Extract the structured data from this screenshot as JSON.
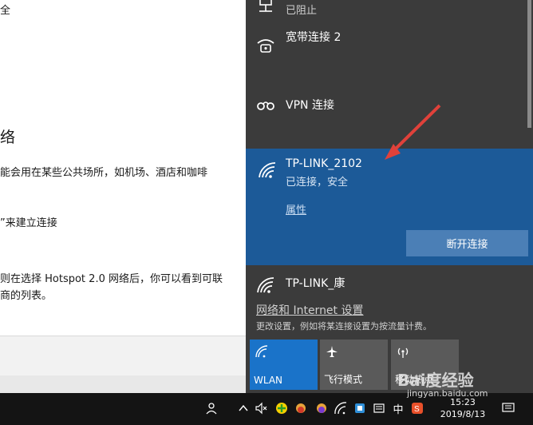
{
  "background_doc": {
    "text_top": "全",
    "heading": "络",
    "line1": "能会用在某些公共场所，如机场、酒店和咖啡",
    "line2": "”来建立连接",
    "line3": "则在选择 Hotspot 2.0 网络后，你可以看到可联",
    "line4": "商的列表。"
  },
  "network_panel": {
    "partial_row_sub": "已阻止",
    "broadband": {
      "label": "宽带连接 2"
    },
    "vpn": {
      "label": "VPN 连接"
    },
    "active_network": {
      "ssid": "TP-LINK_2102",
      "status": "已连接，安全",
      "properties_link": "属性",
      "disconnect_button": "断开连接"
    },
    "other_network": {
      "ssid": "TP-LINK_康"
    },
    "settings_link": "网络和 Internet 设置",
    "settings_sub": "更改设置，例如将某连接设置为按流量计费。",
    "quick_actions": [
      {
        "label": "WLAN",
        "icon": "wifi-icon",
        "active": true
      },
      {
        "label": "飞行模式",
        "icon": "airplane-icon",
        "active": false
      },
      {
        "label": "移动热点",
        "icon": "hotspot-icon",
        "active": false
      }
    ]
  },
  "taskbar": {
    "ime": "中",
    "time": "15:23",
    "date": "2019/8/13"
  },
  "watermark": {
    "text": "Bai度经验",
    "url": "jingyan.baidu.com"
  },
  "colors": {
    "panel_bg": "#3b3b3b",
    "active_bg": "#1c5a98",
    "tile_active": "#1a73c9",
    "tile_inactive": "#5a5a5a",
    "arrow": "#e0413a"
  }
}
